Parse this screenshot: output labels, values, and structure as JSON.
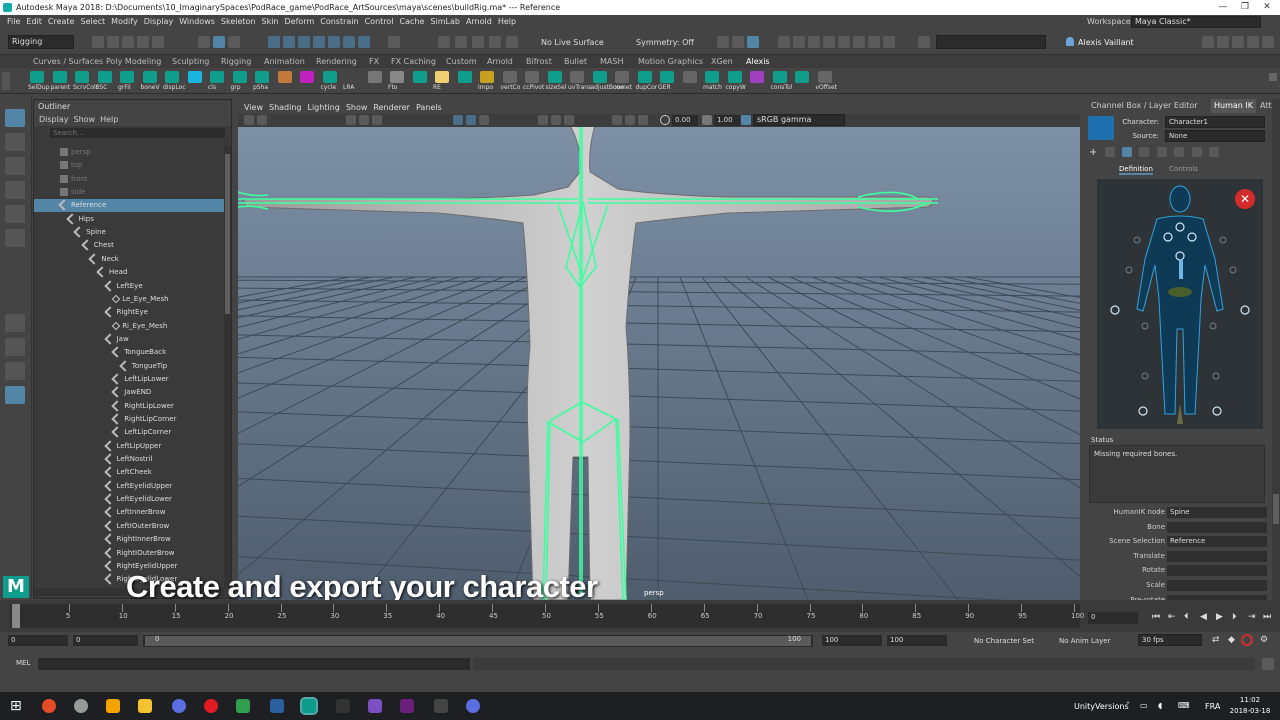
{
  "window": {
    "title": "Autodesk Maya 2018: D:\\Documents\\10_ImaginarySpaces\\PodRace_game\\PodRace_ArtSources\\maya\\scenes\\buildRig.ma*  ---  Reference"
  },
  "menubar": [
    "File",
    "Edit",
    "Create",
    "Select",
    "Modify",
    "Display",
    "Windows",
    "Skeleton",
    "Skin",
    "Deform",
    "Constrain",
    "Control",
    "Cache",
    "SimLab",
    "Arnold",
    "Help"
  ],
  "workspace": {
    "label": "Workspace :",
    "value": "Maya Classic*"
  },
  "statusline": {
    "mode": "Rigging",
    "live_surface": "No Live Surface",
    "symmetry": "Symmetry: Off",
    "user": "Alexis Vaillant"
  },
  "shelf_tabs": [
    "Curves / Surfaces",
    "Poly Modeling",
    "Sculpting",
    "Rigging",
    "Animation",
    "Rendering",
    "FX",
    "FX Caching",
    "Custom",
    "Arnold",
    "Bifrost",
    "Bullet",
    "MASH",
    "Motion Graphics",
    "XGen",
    "Alexis"
  ],
  "shelf_labels": [
    "SelDup",
    "parent",
    "ScrvColc",
    "SSC",
    "grFil",
    "boneV",
    "dispLoc",
    "",
    "cls",
    "grp",
    "pSha",
    "",
    "",
    "cycle",
    "LRA",
    "",
    "Fto",
    "",
    "RE",
    "",
    "Impo",
    "vertCo",
    "ccPivot",
    "sizeSel",
    "uvTrans",
    "adjustBone",
    "comet",
    "dupCor",
    "GER",
    "",
    "match",
    "copyW",
    "",
    "consTol",
    "",
    "vOffset"
  ],
  "outliner": {
    "title": "Outliner",
    "menus": [
      "Display",
      "Show",
      "Help"
    ],
    "search_placeholder": "Search...",
    "rows": [
      {
        "label": "persp",
        "depth": 0,
        "type": "cam",
        "dim": true
      },
      {
        "label": "top",
        "depth": 0,
        "type": "cam",
        "dim": true
      },
      {
        "label": "front",
        "depth": 0,
        "type": "cam",
        "dim": true
      },
      {
        "label": "side",
        "depth": 0,
        "type": "cam",
        "dim": true
      },
      {
        "label": "Reference",
        "depth": 0,
        "type": "joint",
        "sel": true
      },
      {
        "label": "Hips",
        "depth": 1,
        "type": "joint"
      },
      {
        "label": "Spine",
        "depth": 2,
        "type": "joint"
      },
      {
        "label": "Chest",
        "depth": 3,
        "type": "joint"
      },
      {
        "label": "Neck",
        "depth": 4,
        "type": "joint"
      },
      {
        "label": "Head",
        "depth": 5,
        "type": "joint"
      },
      {
        "label": "LeftEye",
        "depth": 6,
        "type": "joint"
      },
      {
        "label": "Le_Eye_Mesh",
        "depth": 7,
        "type": "mesh"
      },
      {
        "label": "RightEye",
        "depth": 6,
        "type": "joint"
      },
      {
        "label": "Ri_Eye_Mesh",
        "depth": 7,
        "type": "mesh"
      },
      {
        "label": "Jaw",
        "depth": 6,
        "type": "joint"
      },
      {
        "label": "TongueBack",
        "depth": 7,
        "type": "joint"
      },
      {
        "label": "TongueTip",
        "depth": 8,
        "type": "joint"
      },
      {
        "label": "LeftLipLower",
        "depth": 7,
        "type": "joint"
      },
      {
        "label": "JawEND",
        "depth": 7,
        "type": "joint"
      },
      {
        "label": "RightLipLower",
        "depth": 7,
        "type": "joint"
      },
      {
        "label": "RightLipCorner",
        "depth": 7,
        "type": "joint"
      },
      {
        "label": "LeftLipCorner",
        "depth": 7,
        "type": "joint"
      },
      {
        "label": "LeftLipUpper",
        "depth": 6,
        "type": "joint"
      },
      {
        "label": "LeftNostril",
        "depth": 6,
        "type": "joint"
      },
      {
        "label": "LeftCheek",
        "depth": 6,
        "type": "joint"
      },
      {
        "label": "LeftEyelidUpper",
        "depth": 6,
        "type": "joint"
      },
      {
        "label": "LeftEyelidLower",
        "depth": 6,
        "type": "joint"
      },
      {
        "label": "LeftInnerBrow",
        "depth": 6,
        "type": "joint"
      },
      {
        "label": "LeftIOuterBrow",
        "depth": 6,
        "type": "joint"
      },
      {
        "label": "RightInnerBrow",
        "depth": 6,
        "type": "joint"
      },
      {
        "label": "RightIOuterBrow",
        "depth": 6,
        "type": "joint"
      },
      {
        "label": "RightEyelidUpper",
        "depth": 6,
        "type": "joint"
      },
      {
        "label": "RightEyelidLower",
        "depth": 6,
        "type": "joint"
      }
    ]
  },
  "viewport": {
    "menus": [
      "View",
      "Shading",
      "Lighting",
      "Show",
      "Renderer",
      "Panels"
    ],
    "exposure": "0.00",
    "gamma": "1.00",
    "colorspace": "sRGB gamma",
    "camera_label": "persp"
  },
  "channelbox": {
    "tabs": [
      "Channel Box / Layer Editor",
      "Human IK",
      "Attr"
    ],
    "character_label": "Character:",
    "character_value": "Character1",
    "source_label": "Source:",
    "source_value": "None",
    "subtabs": [
      "Definition",
      "Controls"
    ],
    "status_label": "Status",
    "status_message": "Missing required bones.",
    "props": [
      {
        "label": "HumanIK node",
        "value": "Spine"
      },
      {
        "label": "Bone",
        "value": ""
      },
      {
        "label": "Scene Selection",
        "value": "Reference"
      },
      {
        "label": "Translate",
        "value": ""
      },
      {
        "label": "Rotate",
        "value": ""
      },
      {
        "label": "Scale",
        "value": ""
      },
      {
        "label": "Pre-rotate",
        "value": ""
      }
    ]
  },
  "caption": "Create and export your character",
  "timeline": {
    "ticks": [
      "0",
      "5",
      "10",
      "15",
      "20",
      "25",
      "30",
      "35",
      "40",
      "45",
      "50",
      "55",
      "60",
      "65",
      "70",
      "75",
      "80",
      "85",
      "90",
      "95",
      "100"
    ],
    "current_frame": "0"
  },
  "range": {
    "start": "0",
    "start_inner": "0",
    "slider_start": "0",
    "slider_end": "100",
    "end_inner": "100",
    "end": "100",
    "char_set": "No Character Set",
    "anim_layer": "No Anim Layer",
    "fps": "30 fps"
  },
  "cmdline": {
    "label": "MEL"
  },
  "taskbar": {
    "tray_label": "UnityVersions",
    "lang": "FRA",
    "time": "11:02",
    "date": "2018-03-18"
  },
  "colors": {
    "accent": "#5285a6",
    "wire": "#3dff9e",
    "sky": "#6b7f95",
    "floor": "#4a5868",
    "close": "#d42c2c"
  }
}
